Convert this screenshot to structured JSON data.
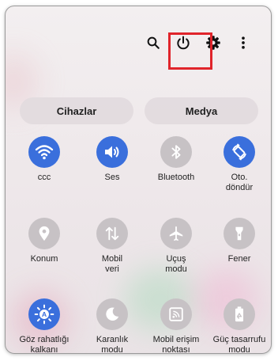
{
  "header": {
    "icons": [
      "search-icon",
      "power-icon",
      "gear-icon",
      "more-vertical-icon"
    ]
  },
  "tabs": {
    "devices": "Cihazlar",
    "media": "Medya"
  },
  "tiles": [
    {
      "label": "ccc",
      "icon": "wifi-icon",
      "active": true
    },
    {
      "label": "Ses",
      "icon": "volume-icon",
      "active": true
    },
    {
      "label": "Bluetooth",
      "icon": "bluetooth-icon",
      "active": false
    },
    {
      "label": "Oto.\ndöndür",
      "icon": "auto-rotate-icon",
      "active": true
    },
    {
      "label": "Konum",
      "icon": "location-icon",
      "active": false
    },
    {
      "label": "Mobil\nveri",
      "icon": "mobile-data-icon",
      "active": false
    },
    {
      "label": "Uçuş\nmodu",
      "icon": "airplane-icon",
      "active": false
    },
    {
      "label": "Fener",
      "icon": "flashlight-icon",
      "active": false
    },
    {
      "label": "Göz rahatlığı\nkalkanı",
      "icon": "eye-comfort-icon",
      "active": true
    },
    {
      "label": "Karanlık\nmodu",
      "icon": "dark-mode-icon",
      "active": false
    },
    {
      "label": "Mobil erişim\nnoktası",
      "icon": "hotspot-icon",
      "active": false
    },
    {
      "label": "Güç tasarrufu\nmodu",
      "icon": "battery-saver-icon",
      "active": false
    }
  ],
  "colors": {
    "active": "#3a6fdc",
    "inactive": "#c7c2c5",
    "highlight": "#e0242b"
  }
}
